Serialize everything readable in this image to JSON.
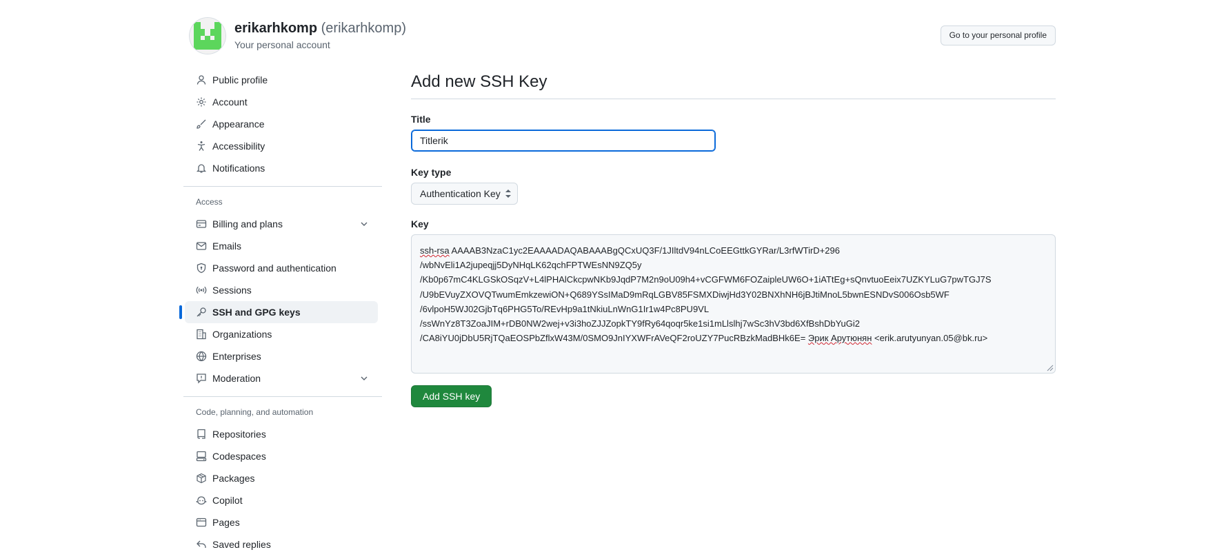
{
  "account": {
    "display_name": "erikarhkomp",
    "login": "(erikarhkomp)",
    "subtitle": "Your personal account",
    "profile_button": "Go to your personal profile"
  },
  "sidebar": {
    "group1": [
      {
        "label": "Public profile",
        "icon": "person-icon"
      },
      {
        "label": "Account",
        "icon": "gear-icon"
      },
      {
        "label": "Appearance",
        "icon": "paintbrush-icon"
      },
      {
        "label": "Accessibility",
        "icon": "accessibility-icon"
      },
      {
        "label": "Notifications",
        "icon": "bell-icon"
      }
    ],
    "access_heading": "Access",
    "group2": [
      {
        "label": "Billing and plans",
        "icon": "credit-card-icon",
        "expandable": true
      },
      {
        "label": "Emails",
        "icon": "mail-icon"
      },
      {
        "label": "Password and authentication",
        "icon": "shield-lock-icon"
      },
      {
        "label": "Sessions",
        "icon": "broadcast-icon"
      },
      {
        "label": "SSH and GPG keys",
        "icon": "key-icon",
        "active": true
      },
      {
        "label": "Organizations",
        "icon": "organization-icon"
      },
      {
        "label": "Enterprises",
        "icon": "globe-icon"
      },
      {
        "label": "Moderation",
        "icon": "report-icon",
        "expandable": true
      }
    ],
    "code_heading": "Code, planning, and automation",
    "group3": [
      {
        "label": "Repositories",
        "icon": "repo-icon"
      },
      {
        "label": "Codespaces",
        "icon": "codespaces-icon"
      },
      {
        "label": "Packages",
        "icon": "package-icon"
      },
      {
        "label": "Copilot",
        "icon": "copilot-icon"
      },
      {
        "label": "Pages",
        "icon": "browser-icon"
      },
      {
        "label": "Saved replies",
        "icon": "reply-icon"
      }
    ]
  },
  "form": {
    "page_title": "Add new SSH Key",
    "title_label": "Title",
    "title_value": "Titlerik",
    "key_type_label": "Key type",
    "key_type_value": "Authentication Key",
    "key_label": "Key",
    "key_lines": [
      " AAAAB3NzaC1yc2EAAAADAQABAAABgQCxUQ3F/1JIltdV94nLCoEEGttkGYRar/L3rfWTirD+296",
      "/wbNvEli1A2jupeqjj5DyNHqLK62qchFPTWEsNN9ZQ5y",
      "/Kb0p67mC4KLGSkOSqzV+L4lPHAlCkcpwNKb9JqdP7M2n9oU09h4+vCGFWM6FOZaipleUW6O+1iATtEg+sQnvtuoEeix7UZKYLuG7pwTGJ7S",
      "/U9bEVuyZXOVQTwumEmkzewiON+Q689YSsIMaD9mRqLGBV85FSMXDiwjHd3Y02BNXhNH6jBJtiMnoL5bwnESNDvS006Osb5WF",
      "/6vlpoH5WJ02GjbTq6PHG5To/REvHp9a1tNkiuLnWnG1Ir1w4Pc8PU9VL",
      "/ssWnYz8T3ZoaJIM+rDB0NW2wej+v3i3hoZJJZopkTY9fRy64qoqr5ke1si1mLlslhj7wSc3hV3bd6XfBshDbYuGi2",
      "/CA8iYU0jDbU5RjTQaEOSPbZflxW43M/0SMO9JnIYXWFrAVeQF2roUZY7PucRBzkMadBHk6E= ",
      " <erik.arutyunyan.05@bk.ru>"
    ],
    "key_prefix": "ssh-rsa",
    "key_name_ru": "Эрик Арутюнян",
    "submit_label": "Add SSH key"
  },
  "colors": {
    "accent": "#0969da",
    "primary_button": "#1f883d",
    "avatar": "#5cd65c"
  }
}
